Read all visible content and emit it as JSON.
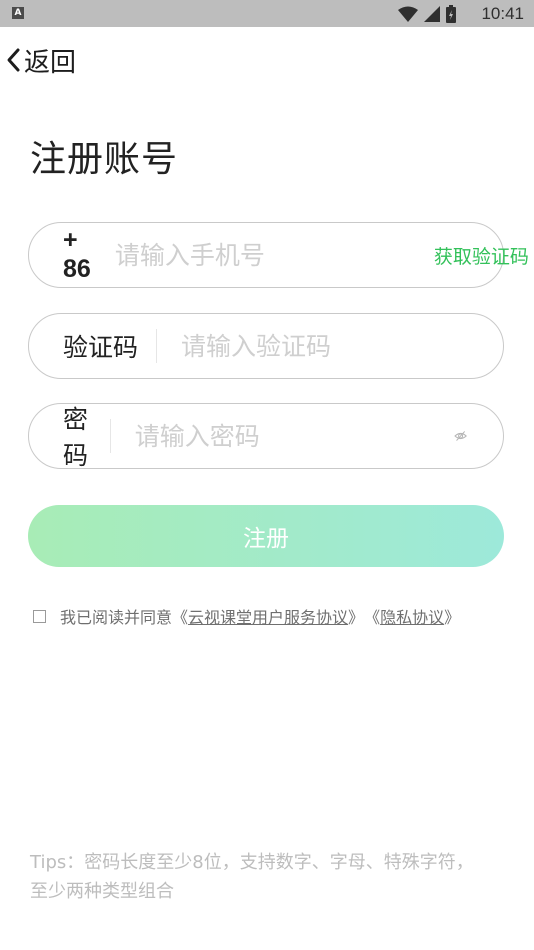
{
  "status_bar": {
    "notif_badge": "A",
    "time": "10:41",
    "icons": [
      "wifi-icon",
      "cellular-signal-icon",
      "battery-icon"
    ]
  },
  "nav": {
    "back_label": "返回"
  },
  "title": "注册账号",
  "phone": {
    "country_code": "+ 86",
    "placeholder": "请输入手机号",
    "get_code_label": "获取验证码"
  },
  "verify": {
    "label": "验证码",
    "placeholder": "请输入验证码"
  },
  "password": {
    "label": "密码",
    "placeholder": "请输入密码",
    "toggle_icon": "eye-off-icon"
  },
  "register_label": "注册",
  "agreement": {
    "prefix": "我已阅读并同意",
    "open1": "《",
    "link1": "云视课堂用户服务协议",
    "close1": "》",
    "open2": "《",
    "link2": "隐私协议",
    "close2": "》"
  },
  "tips": "Tips：密码长度至少8位，支持数字、字母、特殊字符，至少两种类型组合",
  "colors": {
    "accent": "#33c15a",
    "button_gradient_start": "#a8ecb6",
    "button_gradient_end": "#9de9da"
  }
}
